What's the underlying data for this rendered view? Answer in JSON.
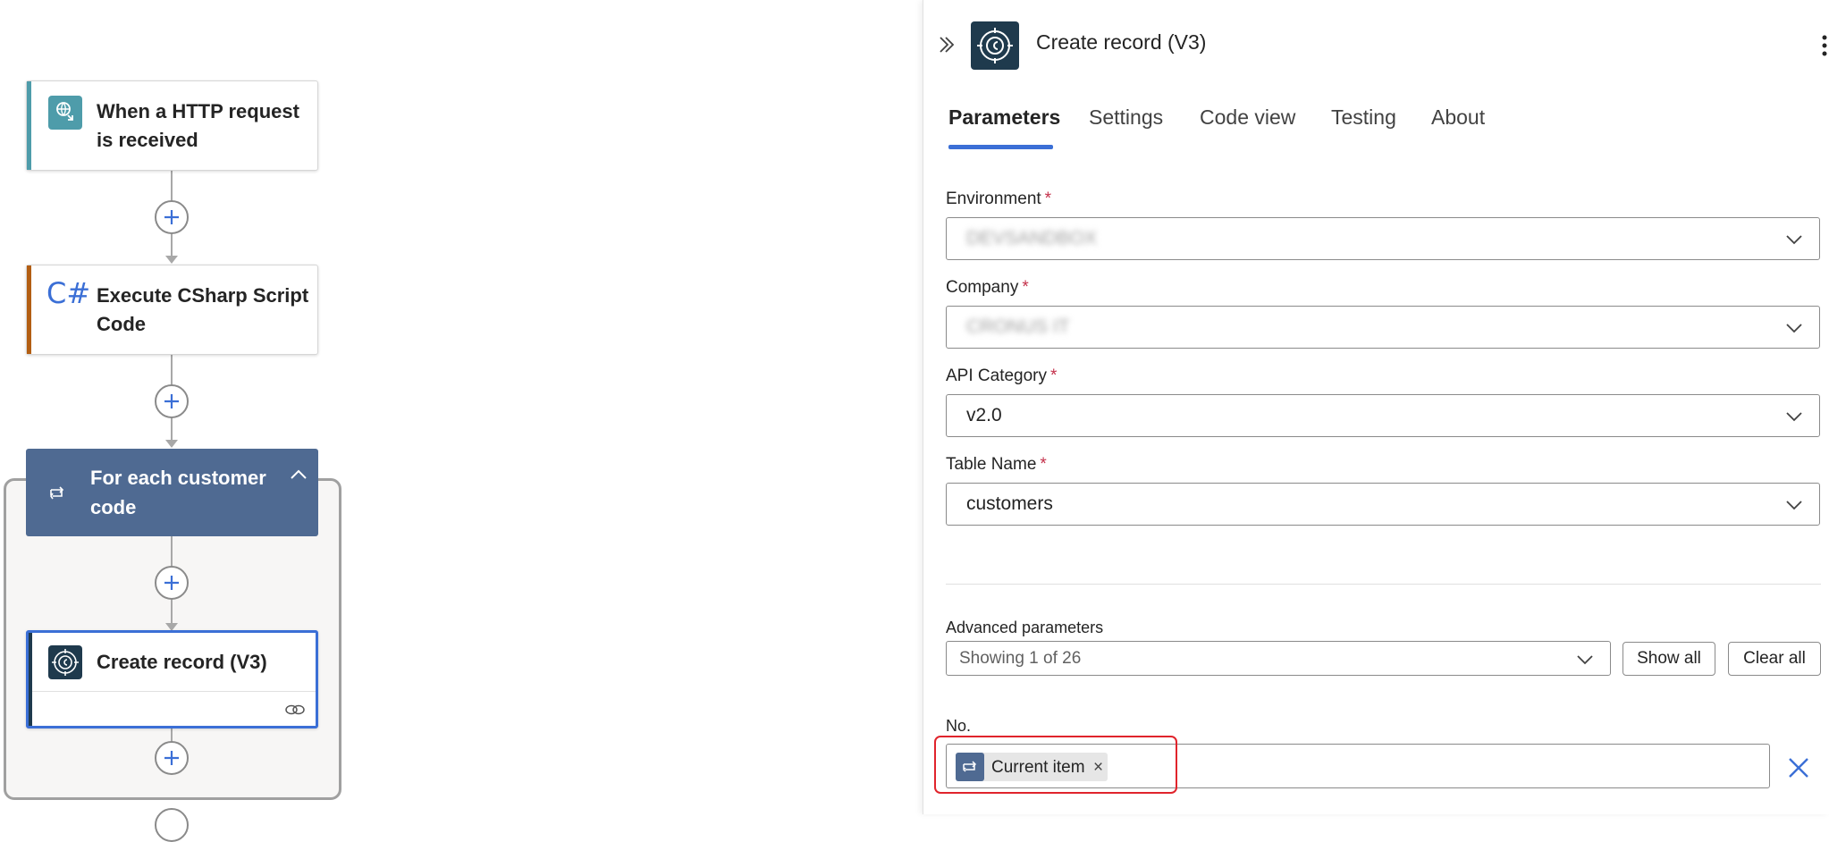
{
  "canvas": {
    "trigger_card": {
      "title": "When a HTTP request is received",
      "icon": "http-request-icon",
      "accent": "#4e9caa"
    },
    "csharp_card": {
      "title": "Execute CSharp Script Code",
      "icon": "csharp-icon",
      "icon_text": "C#",
      "accent": "#b35e13"
    },
    "loop_card": {
      "title": "For each customer code",
      "icon": "loop-icon",
      "accent": "#4f6a92"
    },
    "create_card": {
      "title": "Create record (V3)",
      "icon": "dataverse-icon",
      "footer_icon": "link-icon",
      "accent": "#1f3a4d"
    },
    "add_icon": "plus-icon"
  },
  "panel": {
    "collapse_icon": "double-chevron-right-icon",
    "title": "Create record (V3)",
    "more_icon": "more-vertical-icon",
    "tabs": [
      {
        "label": "Parameters",
        "active": true
      },
      {
        "label": "Settings"
      },
      {
        "label": "Code view"
      },
      {
        "label": "Testing"
      },
      {
        "label": "About"
      }
    ],
    "fields": {
      "environment": {
        "label": "Environment",
        "required": "*",
        "value": "DEVSANDBOX"
      },
      "company": {
        "label": "Company",
        "required": "*",
        "value": "CRONUS IT"
      },
      "api_category": {
        "label": "API Category",
        "required": "*",
        "value": "v2.0"
      },
      "table_name": {
        "label": "Table Name",
        "required": "*",
        "value": "customers"
      }
    },
    "advanced": {
      "label": "Advanced parameters",
      "value": "Showing 1 of 26",
      "show_all": "Show all",
      "clear_all": "Clear all"
    },
    "no_field": {
      "label": "No.",
      "token_label": "Current item",
      "token_remove": "×",
      "clear_icon": "close-icon"
    }
  },
  "colors": {
    "primary": "#3b6fd6",
    "highlight": "#e0242c",
    "loop": "#4f6a92"
  }
}
